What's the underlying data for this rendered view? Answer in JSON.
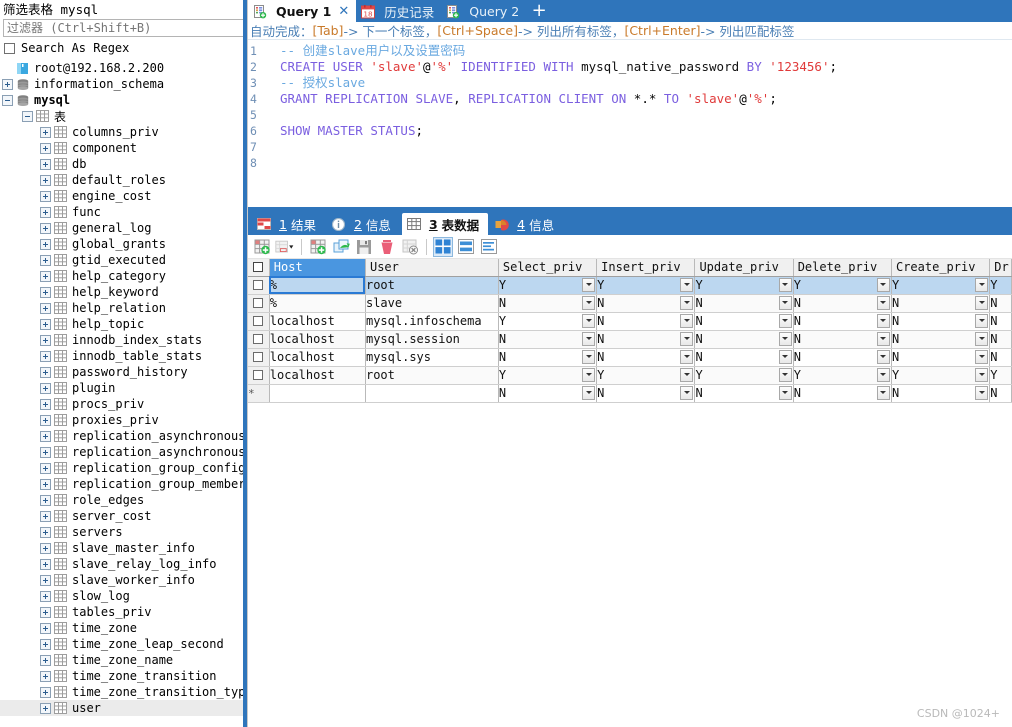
{
  "sidebar": {
    "title": "筛选表格 mysql",
    "filter_placeholder": "过滤器 (Ctrl+Shift+B)",
    "filter_value": "",
    "regex_label": "Search As Regex",
    "connection": "root@192.168.2.200",
    "databases": [
      {
        "label": "information_schema",
        "expanded": false
      },
      {
        "label": "mysql",
        "expanded": true
      }
    ],
    "tables_folder": "表",
    "tables": [
      "columns_priv",
      "component",
      "db",
      "default_roles",
      "engine_cost",
      "func",
      "general_log",
      "global_grants",
      "gtid_executed",
      "help_category",
      "help_keyword",
      "help_relation",
      "help_topic",
      "innodb_index_stats",
      "innodb_table_stats",
      "password_history",
      "plugin",
      "procs_priv",
      "proxies_priv",
      "replication_asynchronous_con",
      "replication_asynchronous_con",
      "replication_group_configurat",
      "replication_group_member_act",
      "role_edges",
      "server_cost",
      "servers",
      "slave_master_info",
      "slave_relay_log_info",
      "slave_worker_info",
      "slow_log",
      "tables_priv",
      "time_zone",
      "time_zone_leap_second",
      "time_zone_name",
      "time_zone_transition",
      "time_zone_transition_type",
      "user"
    ],
    "selected_table": "user"
  },
  "tabs": {
    "items": [
      {
        "label": "Query 1",
        "icon": "query-doc-icon",
        "active": true,
        "closable": true
      },
      {
        "label": "历史记录",
        "icon": "calendar-18-icon",
        "active": false,
        "closable": false
      },
      {
        "label": "Query 2",
        "icon": "query-doc-icon",
        "active": false,
        "closable": false
      }
    ],
    "close_glyph": "✕",
    "add_label": "+"
  },
  "hintbar": {
    "prefix": "自动完成：",
    "segments": [
      {
        "key": "[Tab]",
        "text": "-> 下一个标签，"
      },
      {
        "key": "[Ctrl+Space]",
        "text": "-> 列出所有标签，"
      },
      {
        "key": "[Ctrl+Enter]",
        "text": "-> 列出匹配标签"
      }
    ]
  },
  "editor": {
    "line_numbers": [
      "1",
      "2",
      "3",
      "4",
      "5",
      "6",
      "7",
      "8"
    ],
    "lines": [
      "-- 创建slave用户以及设置密码",
      "CREATE USER 'slave'@'%' IDENTIFIED WITH mysql_native_password BY '123456';",
      "-- 授权slave",
      "GRANT REPLICATION SLAVE, REPLICATION CLIENT ON *.* TO 'slave'@'%';",
      "",
      "SHOW MASTER STATUS;",
      "",
      ""
    ]
  },
  "result_tabs": [
    {
      "num": "1",
      "label": "结果",
      "icon": "result-grid-icon",
      "active": false
    },
    {
      "num": "2",
      "label": "信息",
      "icon": "info-circle-icon",
      "active": false
    },
    {
      "num": "3",
      "label": "表数据",
      "icon": "table-data-icon",
      "active": true
    },
    {
      "num": "4",
      "label": "信息",
      "icon": "pie-chart-icon",
      "active": false
    }
  ],
  "grid_toolbar": [
    {
      "name": "add-record-icon",
      "selected": false
    },
    {
      "name": "copy-record-dropdown-icon",
      "selected": false
    },
    {
      "name": "insert-record-icon",
      "selected": false
    },
    {
      "name": "apply-changes-icon",
      "selected": false
    },
    {
      "name": "save-icon",
      "selected": false
    },
    {
      "name": "delete-record-icon",
      "selected": false
    },
    {
      "name": "revert-icon",
      "selected": false
    },
    {
      "name": "grid-view-icon",
      "selected": true
    },
    {
      "name": "form-view-icon",
      "selected": false
    },
    {
      "name": "text-view-icon",
      "selected": false
    }
  ],
  "grid": {
    "columns": [
      "Host",
      "User",
      "Select_priv",
      "Insert_priv",
      "Update_priv",
      "Delete_priv",
      "Create_priv",
      "Dr"
    ],
    "selected_column": "Host",
    "rows": [
      {
        "marker": "",
        "selected": true,
        "cells": [
          "%",
          "root",
          "Y",
          "Y",
          "Y",
          "Y",
          "Y",
          "Y"
        ]
      },
      {
        "marker": "",
        "selected": false,
        "cells": [
          "%",
          "slave",
          "N",
          "N",
          "N",
          "N",
          "N",
          "N"
        ]
      },
      {
        "marker": "",
        "selected": false,
        "cells": [
          "localhost",
          "mysql.infoschema",
          "Y",
          "N",
          "N",
          "N",
          "N",
          "N"
        ]
      },
      {
        "marker": "",
        "selected": false,
        "cells": [
          "localhost",
          "mysql.session",
          "N",
          "N",
          "N",
          "N",
          "N",
          "N"
        ]
      },
      {
        "marker": "",
        "selected": false,
        "cells": [
          "localhost",
          "mysql.sys",
          "N",
          "N",
          "N",
          "N",
          "N",
          "N"
        ]
      },
      {
        "marker": "",
        "selected": false,
        "cells": [
          "localhost",
          "root",
          "Y",
          "Y",
          "Y",
          "Y",
          "Y",
          "Y"
        ]
      },
      {
        "marker": "*",
        "selected": false,
        "cells": [
          "",
          "",
          "N",
          "N",
          "N",
          "N",
          "N",
          "N"
        ]
      }
    ]
  },
  "watermark": "CSDN @1024+",
  "colors": {
    "accent_blue": "#2f75bb",
    "header_sel": "#4a96e0",
    "row_sel": "#bcd7f0",
    "string_red": "#e03a3a",
    "keyword_purple": "#7b5fe0",
    "comment_blue": "#6aa9e0"
  }
}
